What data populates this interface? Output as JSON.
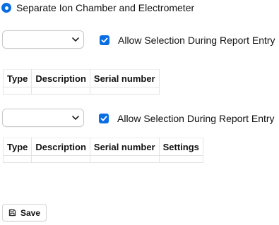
{
  "radio": {
    "label": "Separate Ion Chamber and Electrometer",
    "checked": true
  },
  "ion_chamber": {
    "select_value": "",
    "allow_selection": {
      "label": "Allow Selection During Report Entry",
      "checked": true
    },
    "table": {
      "columns": [
        "Type",
        "Description",
        "Serial number"
      ]
    }
  },
  "electrometer": {
    "select_value": "",
    "allow_selection": {
      "label": "Allow Selection During Report Entry",
      "checked": true
    },
    "table": {
      "columns": [
        "Type",
        "Description",
        "Serial number",
        "Settings"
      ]
    }
  },
  "actions": {
    "save_label": "Save",
    "save_icon": "floppy-disk-icon"
  },
  "colors": {
    "accent": "#0a6ee3",
    "border": "#e3e3e3"
  }
}
